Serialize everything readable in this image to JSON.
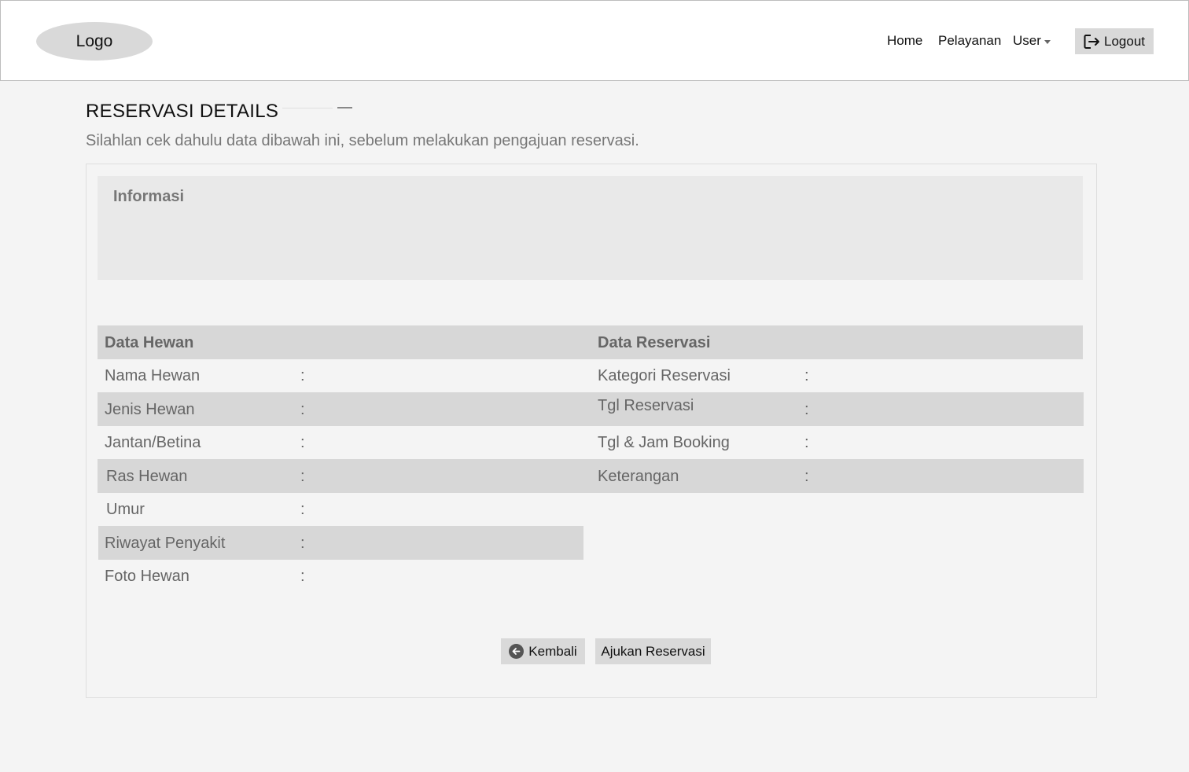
{
  "navbar": {
    "logo": "Logo",
    "links": [
      "Home",
      "Pelayanan"
    ],
    "user_label": "User",
    "logout_label": "Logout",
    "icons": {
      "logout": "logout-icon",
      "user_menu": "caret-down-icon"
    }
  },
  "page": {
    "title": "RESERVASI DETAILS",
    "subtitle": "Silahlan cek dahulu data dibawah ini, sebelum melakukan pengajuan reservasi."
  },
  "info": {
    "title": "Informasi"
  },
  "data_hewan": {
    "heading": "Data Hewan",
    "rows": [
      {
        "label": "Nama Hewan",
        "sep": ":"
      },
      {
        "label": "Jenis Hewan",
        "sep": ":"
      },
      {
        "label": "Jantan/Betina",
        "sep": ":"
      },
      {
        "label": "Ras Hewan",
        "sep": ":"
      },
      {
        "label": "Umur",
        "sep": ":"
      },
      {
        "label": "Riwayat Penyakit",
        "sep": ":"
      },
      {
        "label": "Foto Hewan",
        "sep": ":"
      }
    ]
  },
  "data_reservasi": {
    "heading": "Data Reservasi",
    "rows": [
      {
        "label": "Kategori Reservasi",
        "sep": ":"
      },
      {
        "label": "Tgl Reservasi",
        "sep": ":"
      },
      {
        "label": "Tgl & Jam Booking",
        "sep": ":"
      },
      {
        "label": "Keterangan",
        "sep": ":"
      }
    ]
  },
  "actions": {
    "back_label": "Kembali",
    "submit_label": "Ajukan Reservasi",
    "icons": {
      "back": "arrow-left-circle-icon"
    }
  }
}
